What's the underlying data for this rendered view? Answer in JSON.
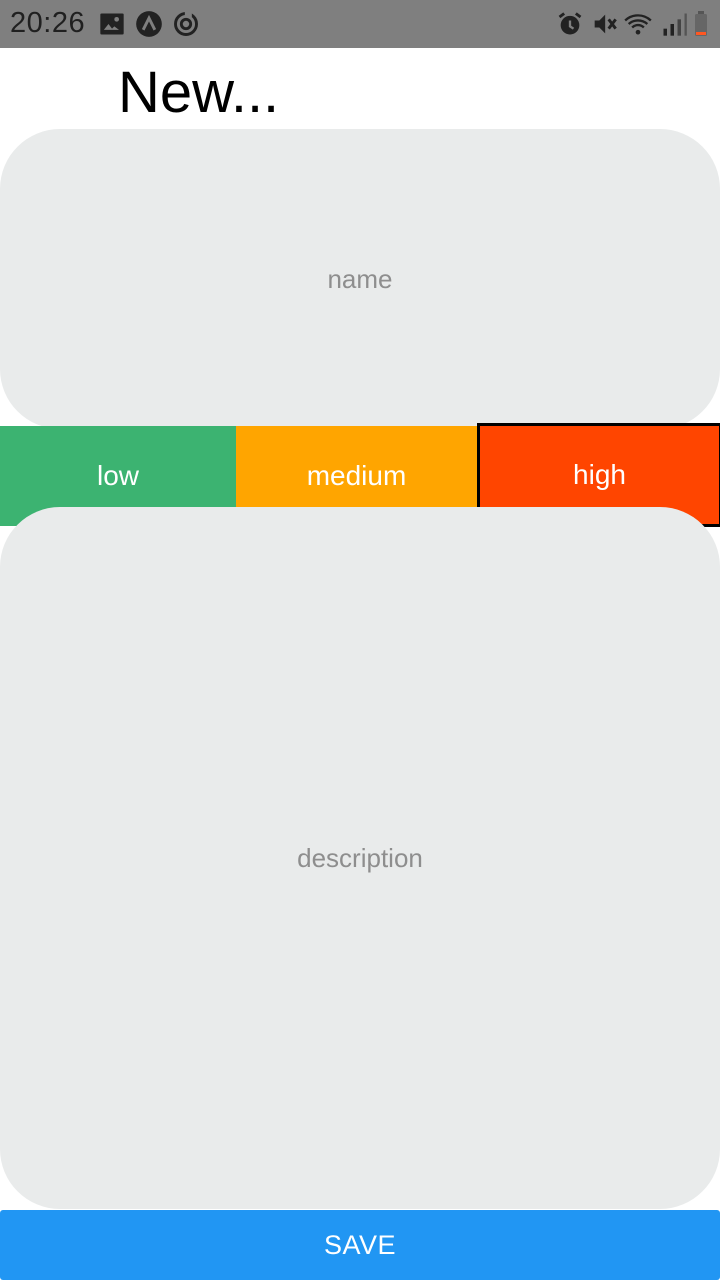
{
  "status_bar": {
    "time": "20:26",
    "left_icons": [
      "image-icon",
      "app-a-icon",
      "sync-icon"
    ],
    "right_icons": [
      "alarm-icon",
      "vibrate-icon",
      "wifi-icon",
      "signal-icon",
      "battery-icon"
    ]
  },
  "page": {
    "title": "New..."
  },
  "form": {
    "name_placeholder": "name",
    "description_placeholder": "description",
    "priorities": [
      {
        "label": "low",
        "color": "#3cb371"
      },
      {
        "label": "medium",
        "color": "#ffa500"
      },
      {
        "label": "high",
        "color": "#ff4500",
        "selected": true
      }
    ],
    "save_label": "SAVE"
  },
  "colors": {
    "status_bar": "#7f7f7f",
    "field_bg": "#e9ebeb",
    "save_button": "#2196f3"
  }
}
